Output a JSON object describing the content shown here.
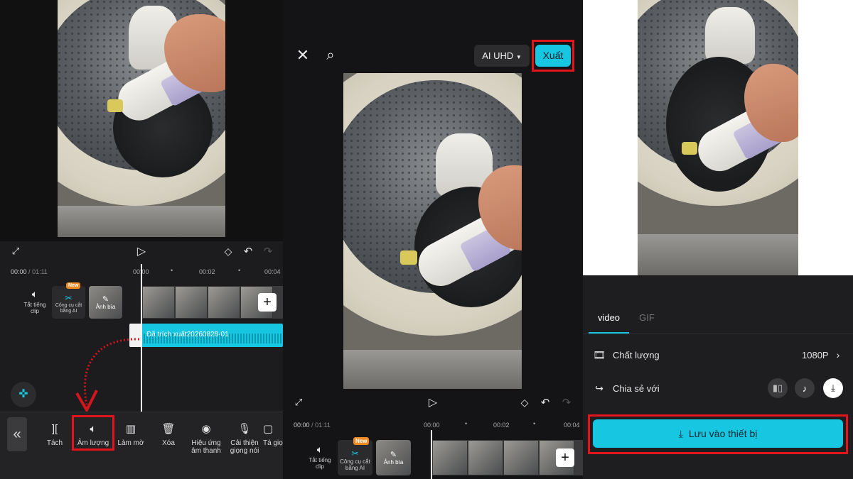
{
  "panel1": {
    "time_current": "00:00",
    "time_separator": "/",
    "time_total": "01:11",
    "ruler": [
      "00:00",
      "00:02",
      "00:04"
    ],
    "left_tools": {
      "mute_label": "Tắt tiếng clip",
      "ai_cut_label": "Công cụ cắt bằng AI",
      "ai_cut_badge": "New",
      "cover_label": "Ảnh bìa"
    },
    "audio_track_label": "Đã trích xuất20260828-01",
    "toolbar": [
      {
        "label": "Tách",
        "icon": "split-icon"
      },
      {
        "label": "Âm lượng",
        "icon": "volume-icon"
      },
      {
        "label": "Làm mờ",
        "icon": "fade-icon"
      },
      {
        "label": "Xóa",
        "icon": "delete-icon"
      },
      {
        "label": "Hiệu ứng âm thanh",
        "icon": "voice-effect-icon"
      },
      {
        "label": "Cải thiện giọng nói",
        "icon": "enhance-voice-icon"
      },
      {
        "label": "Tá giọn",
        "icon": "voice-tool-icon"
      }
    ]
  },
  "panel2": {
    "quality_button": "AI UHD",
    "export_button": "Xuất",
    "time_current": "00:00",
    "time_separator": "/",
    "time_total": "01:11",
    "ruler": [
      "00:00",
      "00:02",
      "00:04"
    ],
    "left_tools": {
      "mute_label": "Tắt tiếng clip",
      "ai_cut_label": "Công cụ cắt bằng AI",
      "ai_cut_badge": "New",
      "cover_label": "Ảnh bìa"
    }
  },
  "panel3": {
    "tabs": [
      "video",
      "GIF"
    ],
    "quality_label": "Chất lượng",
    "quality_value": "1080P",
    "share_label": "Chia sẻ với",
    "save_button": "Lưu vào thiết bị"
  },
  "colors": {
    "accent": "#17c6e0",
    "highlight": "#e3141b",
    "panel_bg": "#1c1c1e"
  }
}
